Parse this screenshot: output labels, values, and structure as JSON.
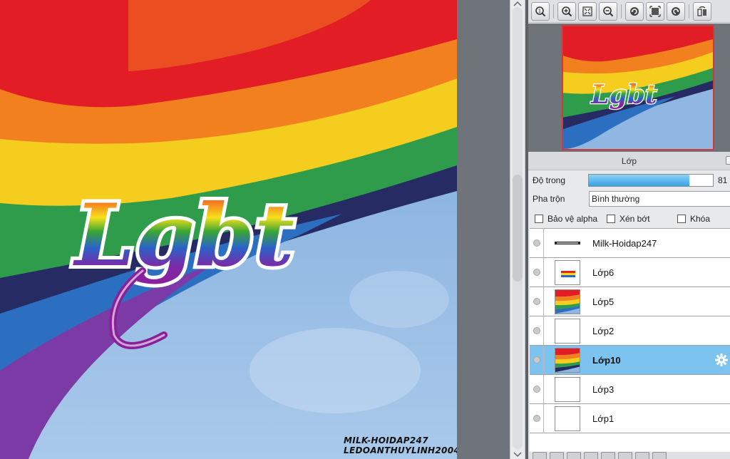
{
  "canvas": {
    "artwork_text": "Lgbt",
    "watermark_line1": "MILK-HOIDAP247",
    "watermark_line2": "LEDOANTHUYLINH2004"
  },
  "navigator": {
    "toolbar": [
      {
        "icon": "zoom-actual-icon"
      },
      {
        "icon": "zoom-in-icon"
      },
      {
        "icon": "fit-screen-icon"
      },
      {
        "icon": "zoom-out-icon"
      },
      {
        "icon": "rotate-left-icon"
      },
      {
        "icon": "fill-window-icon"
      },
      {
        "icon": "rotate-right-icon"
      },
      {
        "icon": "flip-horizontal-icon"
      }
    ],
    "thumbnail_text": "Lgbt"
  },
  "layers_panel": {
    "title": "Lớp",
    "opacity_label": "Độ trong",
    "opacity_value": 81,
    "opacity_display": "81",
    "blend_label": "Pha trộn",
    "blend_value": "Bình thường",
    "checkboxes": [
      {
        "label": "Bảo vệ alpha",
        "checked": false
      },
      {
        "label": "Xén bớt",
        "checked": false
      },
      {
        "label": "Khóa",
        "checked": false
      }
    ],
    "layers": [
      {
        "name": "Milk-Hoidap247",
        "thumb": "text",
        "selected": false
      },
      {
        "name": "Lớp6",
        "thumb": "checker-text",
        "selected": false
      },
      {
        "name": "Lớp5",
        "thumb": "flag",
        "selected": false
      },
      {
        "name": "Lớp2",
        "thumb": "checker",
        "selected": false
      },
      {
        "name": "Lớp10",
        "thumb": "flag",
        "selected": true
      },
      {
        "name": "Lớp3",
        "thumb": "checker",
        "selected": false
      },
      {
        "name": "Lớp1",
        "thumb": "white",
        "selected": false
      }
    ]
  },
  "colors": {
    "selected_row": "#7cc4ef",
    "navigator_frame": "#d23a3a",
    "opacity_fill": "#38a3e6"
  }
}
